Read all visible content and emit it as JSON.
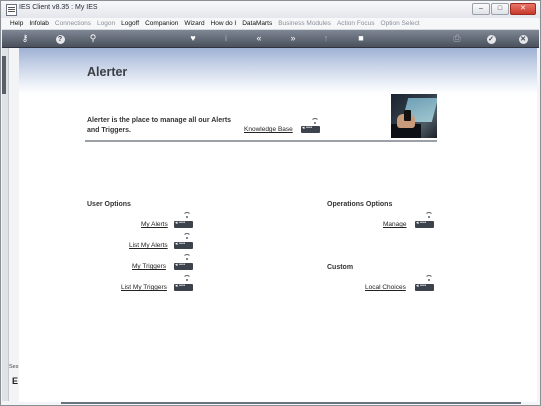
{
  "window": {
    "title": "IES Client v8.35 : My IES"
  },
  "window_controls": {
    "minimize": "–",
    "restore": "□",
    "close": "✕"
  },
  "menu": [
    {
      "label": "Help",
      "enabled": true
    },
    {
      "label": "Infolab",
      "enabled": true
    },
    {
      "label": "Connections",
      "enabled": false
    },
    {
      "label": "Logon",
      "enabled": false
    },
    {
      "label": "Logoff",
      "enabled": true
    },
    {
      "label": "Companion",
      "enabled": true
    },
    {
      "label": "Wizard",
      "enabled": true
    },
    {
      "label": "How do I",
      "enabled": true
    },
    {
      "label": "DataMarts",
      "enabled": true
    },
    {
      "label": "Business Modules",
      "enabled": false
    },
    {
      "label": "Action Focus",
      "enabled": false
    },
    {
      "label": "Option Select",
      "enabled": false
    }
  ],
  "toolbar": {
    "icons": [
      "key-icon",
      "help-icon",
      "search-icon",
      "heart-icon",
      "info-icon",
      "back-icon",
      "forward-icon",
      "upload-icon",
      "stop-icon",
      "print-icon",
      "check-icon",
      "close-icon"
    ],
    "glyphs": {
      "key": "⚷",
      "help": "?",
      "search": "⚲",
      "heart": "♥",
      "info": "i",
      "back": "«",
      "forward": "»",
      "upload": "↑",
      "stop": "■",
      "print": "⎙",
      "check": "✓",
      "close": "✕"
    }
  },
  "side_panel": {
    "label": "Ses",
    "glyph": "E"
  },
  "page": {
    "title": "Alerter",
    "intro": "Alerter is the place to manage all our Alerts and Triggers.",
    "knowledge_base": "Knowledge Base"
  },
  "user_options": {
    "heading": "User Options",
    "links": [
      "My Alerts",
      "List My Alerts",
      "My Triggers",
      "List My Triggers"
    ]
  },
  "operations_options": {
    "heading": "Operations Options",
    "links": [
      "Manage"
    ]
  },
  "custom": {
    "heading": "Custom",
    "links": [
      "Local Choices"
    ]
  },
  "colors": {
    "toolbar": "#5a616d",
    "banner": "#9fb2d4",
    "close_button": "#c9392c"
  }
}
